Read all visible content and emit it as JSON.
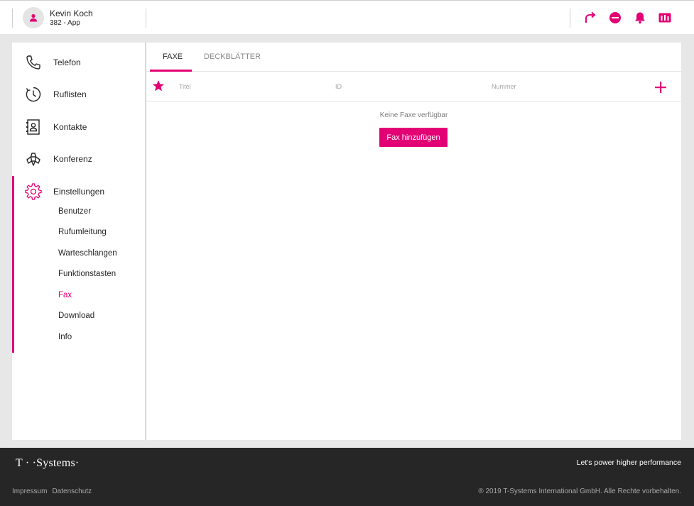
{
  "header": {
    "user_name": "Kevin Koch",
    "user_sub": "382 - App",
    "icons": [
      "forward-icon",
      "do-not-disturb-icon",
      "bell-icon",
      "switchboard-icon"
    ]
  },
  "sidebar": {
    "items": [
      {
        "label": "Telefon",
        "icon": "phone-icon"
      },
      {
        "label": "Ruflisten",
        "icon": "call-history-icon"
      },
      {
        "label": "Kontakte",
        "icon": "contacts-icon"
      },
      {
        "label": "Konferenz",
        "icon": "conference-icon"
      },
      {
        "label": "Einstellungen",
        "icon": "gear-icon"
      }
    ],
    "subitems": [
      {
        "label": "Benutzer"
      },
      {
        "label": "Rufumleitung"
      },
      {
        "label": "Warteschlangen"
      },
      {
        "label": "Funktionstasten"
      },
      {
        "label": "Fax",
        "active": true
      },
      {
        "label": "Download"
      },
      {
        "label": "Info"
      }
    ]
  },
  "main": {
    "tabs": [
      {
        "label": "FAXE",
        "active": true
      },
      {
        "label": "DECKBLÄTTER",
        "active": false
      }
    ],
    "columns": [
      "Titel",
      "ID",
      "Nummer"
    ],
    "empty_text": "Keine Faxe verfügbar",
    "add_button": "Fax hinzufügen"
  },
  "footer": {
    "logo": "T · ·Systems·",
    "tagline": "Let's power higher performance",
    "links": [
      "Impressum",
      "Datenschutz"
    ],
    "copyright": "® 2019 T-Systems International GmbH. Alle Rechte vorbehalten."
  },
  "colors": {
    "accent": "#e20074",
    "footer_bg": "#262626",
    "page_bg": "#e7e7e7"
  }
}
